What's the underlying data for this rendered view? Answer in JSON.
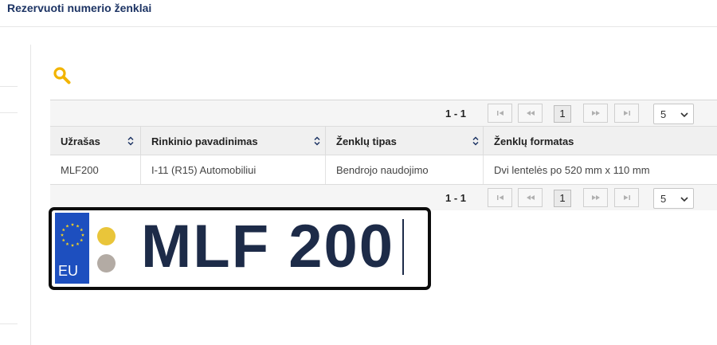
{
  "page": {
    "title": "Rezervuoti numerio ženklai"
  },
  "colors": {
    "title": "#1d3464",
    "search_icon": "#f2b400",
    "eu_blue": "#1d4fbf",
    "plate_text": "#1d2b48",
    "dot_yellow": "#e9c53a",
    "dot_gray": "#b3aba4"
  },
  "search": {
    "icon": "search-icon"
  },
  "pager": {
    "range": "1 - 1",
    "current_page": "1",
    "page_size": "5",
    "icons": {
      "first": "first-page-icon",
      "prev": "prev-page-icon",
      "next": "next-page-icon",
      "last": "last-page-icon",
      "dropdown": "chevron-down-icon"
    }
  },
  "grid": {
    "columns": [
      "Užrašas",
      "Rinkinio pavadinimas",
      "Ženklų tipas",
      "Ženklų formatas"
    ],
    "rows": [
      [
        "MLF200",
        "I-11 (R15) Automobiliui",
        "Bendrojo naudojimo",
        "Dvi lentelės po 520 mm x 110 mm"
      ]
    ]
  },
  "plate": {
    "country_code": "EU",
    "text": "MLF 200"
  }
}
